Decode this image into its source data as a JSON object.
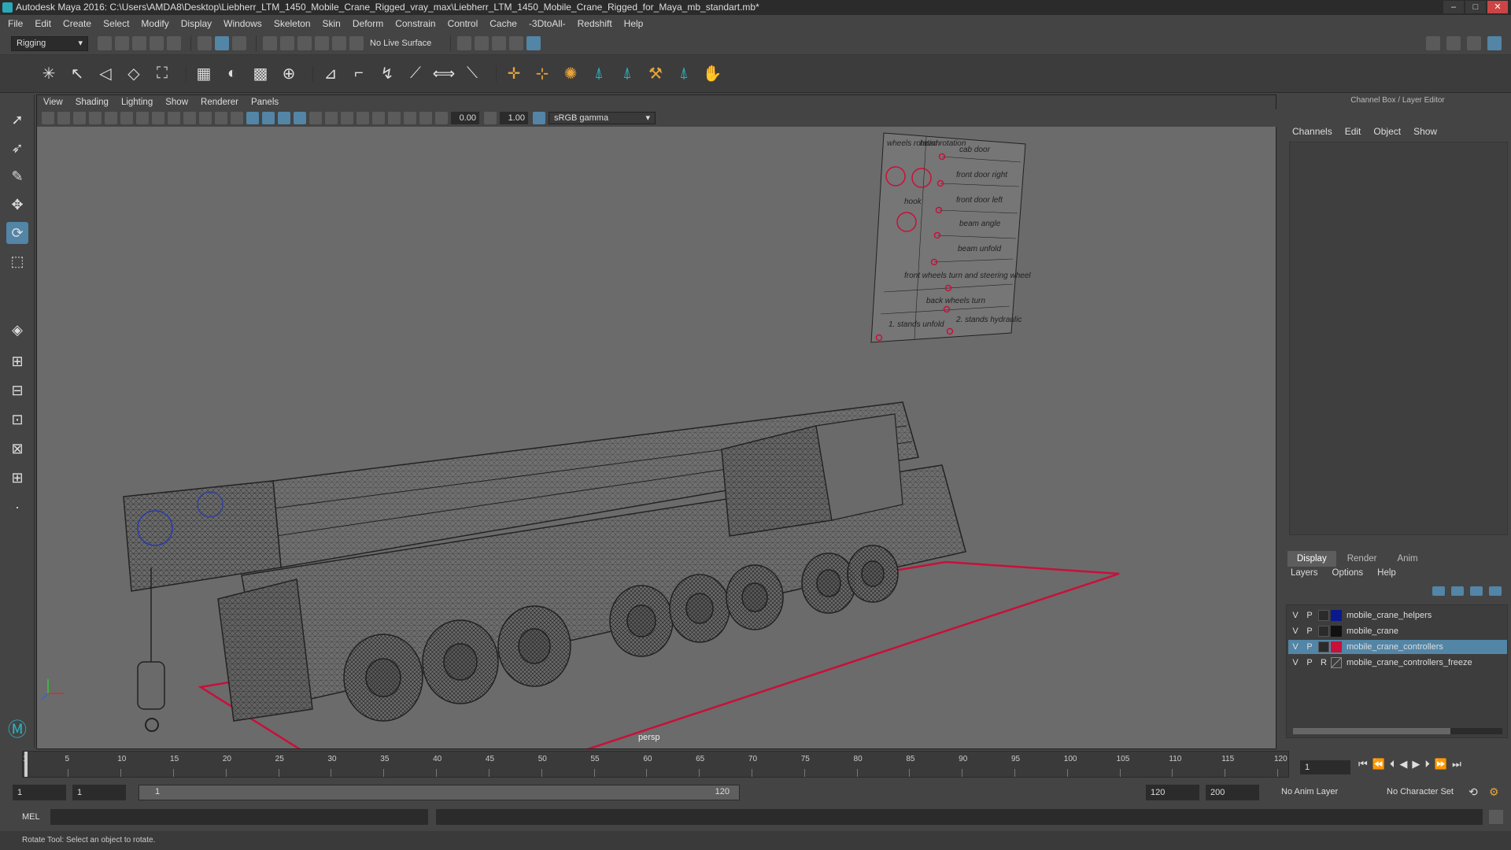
{
  "window": {
    "title": "Autodesk Maya 2016: C:\\Users\\AMDA8\\Desktop\\Liebherr_LTM_1450_Mobile_Crane_Rigged_vray_max\\Liebherr_LTM_1450_Mobile_Crane_Rigged_for_Maya_mb_standart.mb*",
    "controls": [
      "–",
      "□",
      "✕"
    ]
  },
  "menubar": [
    "File",
    "Edit",
    "Create",
    "Select",
    "Modify",
    "Display",
    "Windows",
    "Skeleton",
    "Skin",
    "Deform",
    "Constrain",
    "Control",
    "Cache",
    "-3DtoAll-",
    "Redshift",
    "Help"
  ],
  "statusline": {
    "mode": "Rigging",
    "live_surface": "No Live Surface"
  },
  "viewport": {
    "menus": [
      "View",
      "Shading",
      "Lighting",
      "Show",
      "Renderer",
      "Panels"
    ],
    "exposure": "0.00",
    "gamma": "1.00",
    "color_space": "sRGB gamma",
    "camera_label": "persp"
  },
  "control_panel": {
    "labels": {
      "wheels_rotation": "wheels rotation",
      "head_rotation": "head rotation",
      "hook": "hook",
      "cab_door": "cab door",
      "front_door_right": "front door right",
      "front_door_left": "front door left",
      "beam_angle": "beam angle",
      "beam_unfold": "beam unfold",
      "front_wheels_turn": "front wheels turn and steering wheel",
      "back_wheels_turn": "back wheels turn",
      "stands_unfold": "1. stands unfold",
      "stands_hydraulic": "2. stands hydraulic"
    }
  },
  "channel_box": {
    "header": "Channel Box / Layer Editor",
    "menus": [
      "Channels",
      "Edit",
      "Object",
      "Show"
    ]
  },
  "layer_editor": {
    "tabs": [
      "Display",
      "Render",
      "Anim"
    ],
    "active_tab": "Display",
    "menus": [
      "Layers",
      "Options",
      "Help"
    ],
    "layers": [
      {
        "v": "V",
        "p": "P",
        "r": "",
        "color": "#0a1a8c",
        "name": "mobile_crane_helpers",
        "selected": false
      },
      {
        "v": "V",
        "p": "P",
        "r": "",
        "color": "#111111",
        "name": "mobile_crane",
        "selected": false
      },
      {
        "v": "V",
        "p": "P",
        "r": "",
        "color": "#c8103a",
        "name": "mobile_crane_controllers",
        "selected": true
      },
      {
        "v": "V",
        "p": "P",
        "r": "R",
        "color": "",
        "name": "mobile_crane_controllers_freeze",
        "selected": false
      }
    ]
  },
  "timeline": {
    "ticks": [
      "1",
      "5",
      "10",
      "15",
      "20",
      "25",
      "30",
      "35",
      "40",
      "45",
      "50",
      "55",
      "60",
      "65",
      "70",
      "75",
      "80",
      "85",
      "90",
      "95",
      "100",
      "105",
      "110",
      "115",
      "120"
    ],
    "current_frame": "1",
    "play_icons": [
      "⏮",
      "⏪",
      "⏴",
      "◀",
      "▶",
      "⏵",
      "⏩",
      "⏭"
    ]
  },
  "range": {
    "start": "1",
    "start_inner": "1",
    "slider_start": "1",
    "slider_end": "120",
    "end_inner": "120",
    "end": "200",
    "anim_layer": "No Anim Layer",
    "character_set": "No Character Set"
  },
  "command": {
    "lang": "MEL"
  },
  "help": {
    "text": "Rotate Tool: Select an object to rotate."
  }
}
